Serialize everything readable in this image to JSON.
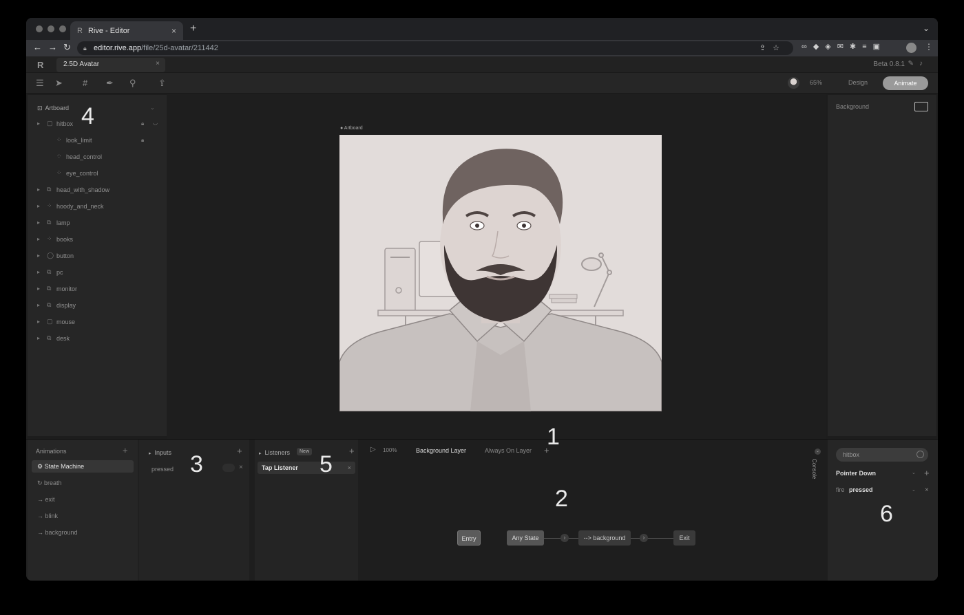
{
  "browser": {
    "tab_title": "Rive - Editor",
    "tab_close": "×",
    "new_tab": "+",
    "url_host": "editor.rive.app",
    "url_path": "/file/25d-avatar/211442"
  },
  "rive": {
    "logo": "R",
    "file_tab": "2.5D Avatar",
    "file_close": "×",
    "version": "Beta 0.8.1",
    "zoom": "65%",
    "mode_design": "Design",
    "mode_animate": "Animate"
  },
  "hierarchy": {
    "root": "Artboard",
    "items": [
      {
        "label": "hitbox",
        "icon": "shape-icon",
        "locked": true
      },
      {
        "label": "look_limit",
        "icon": "group-icon",
        "locked": true
      },
      {
        "label": "head_control",
        "icon": "group-icon",
        "locked": false
      },
      {
        "label": "eye_control",
        "icon": "group-icon",
        "locked": false
      },
      {
        "label": "head_with_shadow",
        "icon": "multi-shape-icon",
        "locked": false
      },
      {
        "label": "hoody_and_neck",
        "icon": "group-icon",
        "locked": false
      },
      {
        "label": "lamp",
        "icon": "multi-shape-icon",
        "locked": false
      },
      {
        "label": "books",
        "icon": "group-icon",
        "locked": false
      },
      {
        "label": "button",
        "icon": "ellipse-icon",
        "locked": false
      },
      {
        "label": "pc",
        "icon": "multi-shape-icon",
        "locked": false
      },
      {
        "label": "monitor",
        "icon": "multi-shape-icon",
        "locked": false
      },
      {
        "label": "display",
        "icon": "multi-shape-icon",
        "locked": false
      },
      {
        "label": "mouse",
        "icon": "shape-icon",
        "locked": false
      },
      {
        "label": "desk",
        "icon": "multi-shape-icon",
        "locked": false
      }
    ]
  },
  "canvas": {
    "artboard_label": "Artboard"
  },
  "inspector": {
    "background_label": "Background"
  },
  "animations": {
    "header": "Animations",
    "items": [
      {
        "label": "State Machine",
        "selected": true
      },
      {
        "label": "breath",
        "selected": false
      },
      {
        "label": "exit",
        "selected": false
      },
      {
        "label": "blink",
        "selected": false
      },
      {
        "label": "background",
        "selected": false
      }
    ]
  },
  "state_machine": {
    "inputs_header": "Inputs",
    "input_name": "pressed",
    "listeners_header": "Listeners",
    "listeners_badge": "New",
    "listener_name": "Tap Listener",
    "playback_pct": "100%",
    "layer_active": "Background Layer",
    "layer_other": "Always On Layer",
    "nodes": {
      "entry": "Entry",
      "any": "Any State",
      "background": "--> background",
      "exit": "Exit"
    },
    "console": "Console"
  },
  "listener_props": {
    "target": "hitbox",
    "event": "Pointer Down",
    "action_label": "fire",
    "action_value": "pressed"
  },
  "callouts": {
    "c1": "1",
    "c2": "2",
    "c3": "3",
    "c4": "4",
    "c5": "5",
    "c6": "6"
  }
}
